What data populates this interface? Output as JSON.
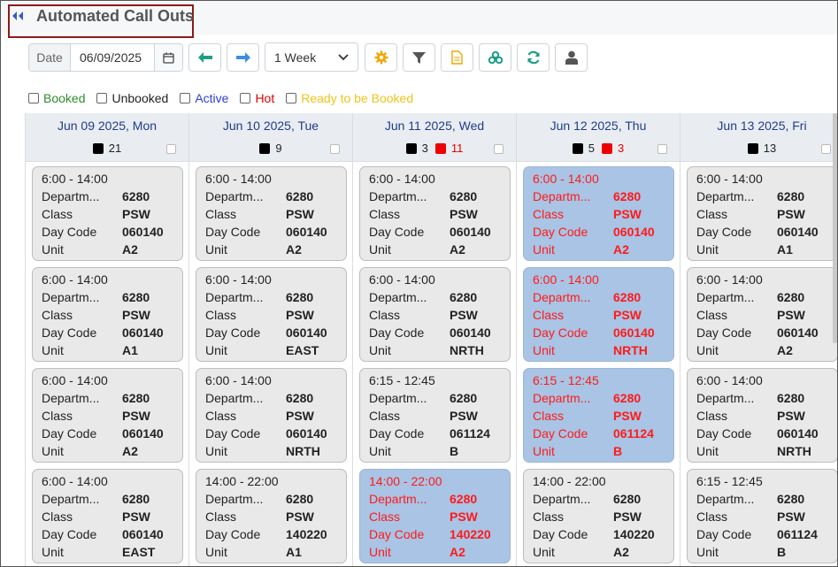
{
  "header": {
    "title": "Automated Call Outs",
    "back_icon": "double-chevron-left-icon"
  },
  "toolbar": {
    "date_label": "Date",
    "date_value": "06/09/2025",
    "range_value": "1 Week",
    "icons": [
      "arrow-left-icon",
      "arrow-right-icon",
      "gear-icon",
      "filter-icon",
      "document-icon",
      "network-icon",
      "refresh-icon",
      "user-icon"
    ]
  },
  "legend": [
    {
      "label": "Booked",
      "color": "#2e8b2e"
    },
    {
      "label": "Unbooked",
      "color": "#222222"
    },
    {
      "label": "Active",
      "color": "#2b3fd6"
    },
    {
      "label": "Hot",
      "color": "#e00000"
    },
    {
      "label": "Ready to be Booked",
      "color": "#f0c419"
    }
  ],
  "card_labels": {
    "dept": "Departm...",
    "class": "Class",
    "daycode": "Day Code",
    "unit": "Unit"
  },
  "days": [
    {
      "title": "Jun 09 2025, Mon",
      "black_count": "21",
      "red_count": null,
      "cards": [
        {
          "time": "6:00 - 14:00",
          "dept": "6280",
          "class": "PSW",
          "daycode": "060140",
          "unit": "A2",
          "hot": false
        },
        {
          "time": "6:00 - 14:00",
          "dept": "6280",
          "class": "PSW",
          "daycode": "060140",
          "unit": "A1",
          "hot": false
        },
        {
          "time": "6:00 - 14:00",
          "dept": "6280",
          "class": "PSW",
          "daycode": "060140",
          "unit": "A2",
          "hot": false
        },
        {
          "time": "6:00 - 14:00",
          "dept": "6280",
          "class": "PSW",
          "daycode": "060140",
          "unit": "EAST",
          "hot": false
        }
      ]
    },
    {
      "title": "Jun 10 2025, Tue",
      "black_count": "9",
      "red_count": null,
      "cards": [
        {
          "time": "6:00 - 14:00",
          "dept": "6280",
          "class": "PSW",
          "daycode": "060140",
          "unit": "A2",
          "hot": false
        },
        {
          "time": "6:00 - 14:00",
          "dept": "6280",
          "class": "PSW",
          "daycode": "060140",
          "unit": "EAST",
          "hot": false
        },
        {
          "time": "6:00 - 14:00",
          "dept": "6280",
          "class": "PSW",
          "daycode": "060140",
          "unit": "NRTH",
          "hot": false
        },
        {
          "time": "14:00 - 22:00",
          "dept": "6280",
          "class": "PSW",
          "daycode": "140220",
          "unit": "A1",
          "hot": false
        }
      ]
    },
    {
      "title": "Jun 11 2025, Wed",
      "black_count": "3",
      "red_count": "11",
      "cards": [
        {
          "time": "6:00 - 14:00",
          "dept": "6280",
          "class": "PSW",
          "daycode": "060140",
          "unit": "A2",
          "hot": false
        },
        {
          "time": "6:00 - 14:00",
          "dept": "6280",
          "class": "PSW",
          "daycode": "060140",
          "unit": "NRTH",
          "hot": false
        },
        {
          "time": "6:15 - 12:45",
          "dept": "6280",
          "class": "PSW",
          "daycode": "061124",
          "unit": "B",
          "hot": false
        },
        {
          "time": "14:00 - 22:00",
          "dept": "6280",
          "class": "PSW",
          "daycode": "140220",
          "unit": "A2",
          "hot": true
        }
      ]
    },
    {
      "title": "Jun 12 2025, Thu",
      "black_count": "5",
      "red_count": "3",
      "cards": [
        {
          "time": "6:00 - 14:00",
          "dept": "6280",
          "class": "PSW",
          "daycode": "060140",
          "unit": "A2",
          "hot": true
        },
        {
          "time": "6:00 - 14:00",
          "dept": "6280",
          "class": "PSW",
          "daycode": "060140",
          "unit": "NRTH",
          "hot": true
        },
        {
          "time": "6:15 - 12:45",
          "dept": "6280",
          "class": "PSW",
          "daycode": "061124",
          "unit": "B",
          "hot": true
        },
        {
          "time": "14:00 - 22:00",
          "dept": "6280",
          "class": "PSW",
          "daycode": "140220",
          "unit": "A2",
          "hot": false
        }
      ]
    },
    {
      "title": "Jun 13 2025, Fri",
      "black_count": "13",
      "red_count": null,
      "cards": [
        {
          "time": "6:00 - 14:00",
          "dept": "6280",
          "class": "PSW",
          "daycode": "060140",
          "unit": "A1",
          "hot": false
        },
        {
          "time": "6:00 - 14:00",
          "dept": "6280",
          "class": "PSW",
          "daycode": "060140",
          "unit": "A2",
          "hot": false
        },
        {
          "time": "6:00 - 14:00",
          "dept": "6280",
          "class": "PSW",
          "daycode": "060140",
          "unit": "NRTH",
          "hot": false
        },
        {
          "time": "6:15 - 12:45",
          "dept": "6280",
          "class": "PSW",
          "daycode": "061124",
          "unit": "B",
          "hot": false
        }
      ]
    }
  ]
}
